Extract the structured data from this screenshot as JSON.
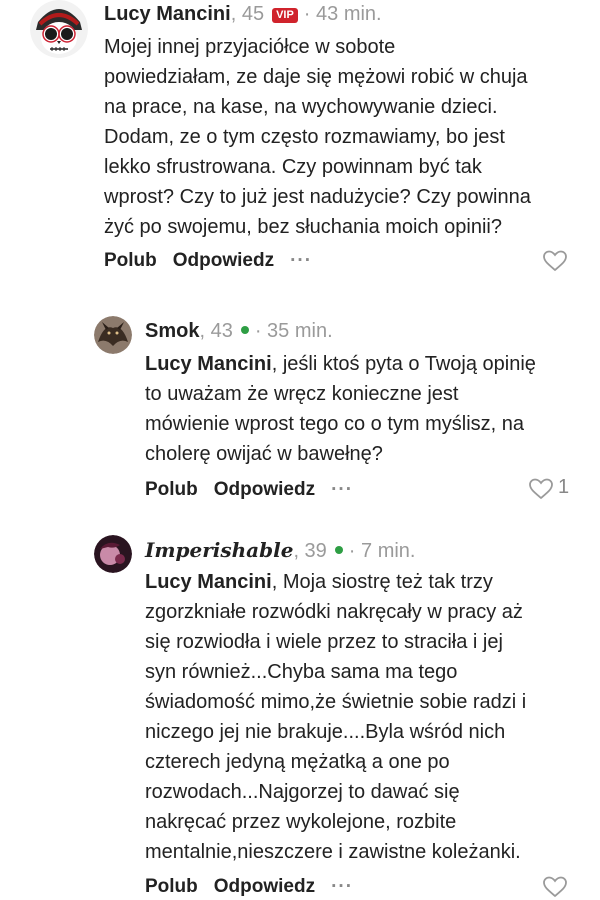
{
  "comments": [
    {
      "author": "Lucy Mancini",
      "age": ", 45",
      "badge": "VIP",
      "time": "· 43 min.",
      "mention": "",
      "text": "Mojej innej przyjaciółce w sobote\npowiedziałam, ze daje się mężowi robić w chuja\nna prace, na kase, na wychowywanie dzieci.\nDodam, ze o tym często rozmawiamy, bo jest\nlekko sfrustrowana. Czy powinnam być tak\nwprost? Czy to już jest nadużycie? Czy powinna\nżyć po swojemu, bez słuchania moich opinii?",
      "like_label": "Polub",
      "reply_label": "Odpowiedz",
      "more": "···",
      "like_count": ""
    },
    {
      "author": "Smok",
      "age": ", 43",
      "time": "· 35 min.",
      "mention": "Lucy Mancini",
      "text": ", jeśli ktoś pyta o Twoją opinię\nto uważam że wręcz konieczne jest\nmówienie wprost tego co o tym myślisz, na\ncholerę owijać w bawełnę?",
      "like_label": "Polub",
      "reply_label": "Odpowiedz",
      "more": "···",
      "like_count": "1"
    },
    {
      "author": "Imperishable",
      "age": ", 39",
      "time": "· 7 min.",
      "mention": "Lucy Mancini",
      "text": ", Moja siostrę też tak trzy\nzgorzkniałe rozwódki nakręcały w pracy aż\nsię rozwiodła i wiele przez to straciła i jej\nsyn również...Chyba sama ma tego\nświadomość mimo,że świetnie sobie radzi i\nniczego jej nie brakuje....Byla wśród nich\nczterech jedyną mężatką a one po\nrozwodach...Najgorzej to dawać się\nnakręcać przez wykolejone, rozbite\nmentalnie,nieszczere i zawistne koleżanki.",
      "like_label": "Polub",
      "reply_label": "Odpowiedz",
      "more": "···",
      "like_count": ""
    }
  ]
}
